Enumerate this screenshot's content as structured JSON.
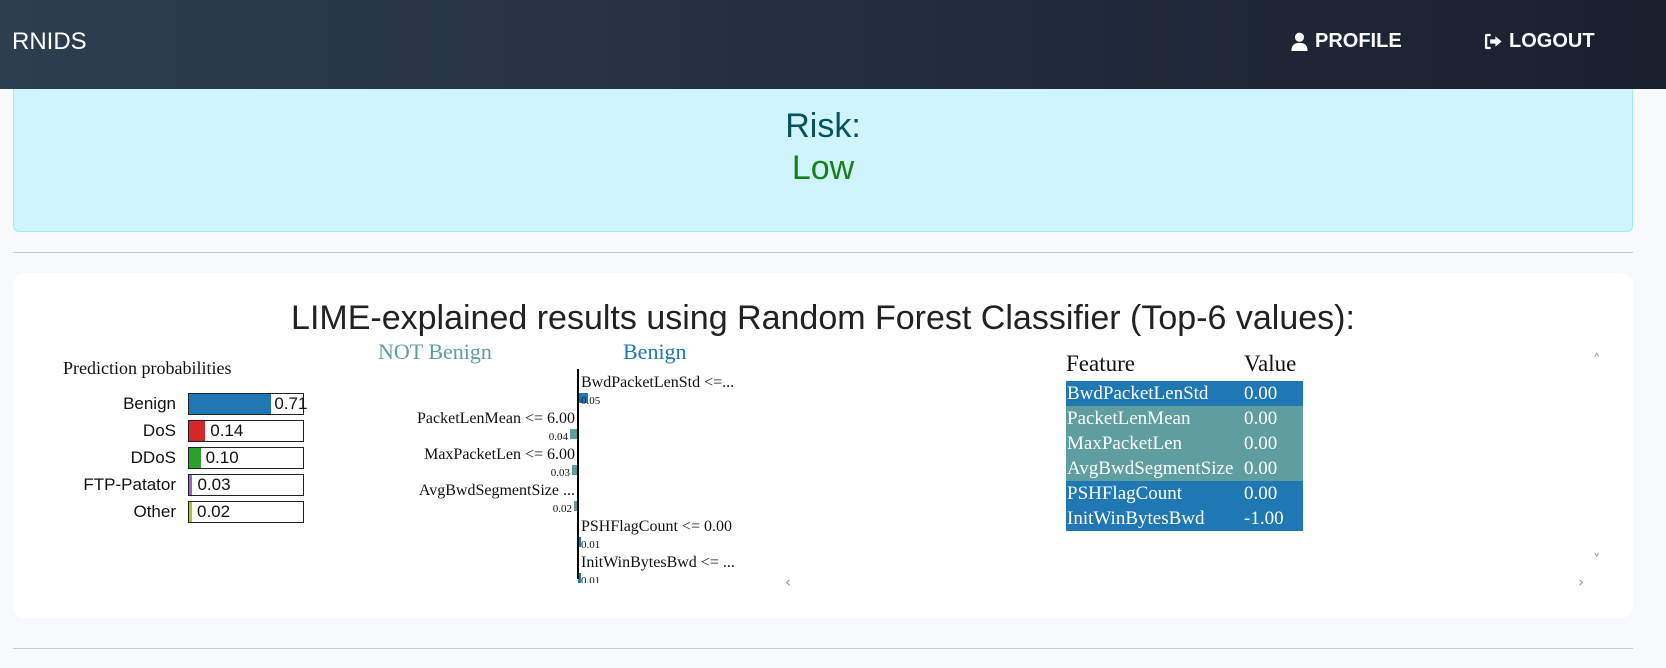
{
  "nav": {
    "brand": "RNIDS",
    "profile_label": "PROFILE",
    "logout_label": "LOGOUT"
  },
  "risk": {
    "label": "Risk:",
    "value": "Low",
    "value_color": "#198019"
  },
  "lime": {
    "title": "LIME-explained results using Random Forest Classifier (Top-6 values):",
    "prediction_title": "Prediction probabilities",
    "probabilities": [
      {
        "name": "Benign",
        "value": 0.71,
        "label": "0.71",
        "color": "#1f77b4"
      },
      {
        "name": "DoS",
        "value": 0.14,
        "label": "0.14",
        "color": "#d62728"
      },
      {
        "name": "DDoS",
        "value": 0.1,
        "label": "0.10",
        "color": "#2ca02c"
      },
      {
        "name": "FTP-Patator",
        "value": 0.03,
        "label": "0.03",
        "color": "#9467bd"
      },
      {
        "name": "Other",
        "value": 0.02,
        "label": "0.02",
        "color": "#bcbd22"
      }
    ],
    "explanation": {
      "neg_label": "NOT Benign",
      "pos_label": "Benign",
      "neg_color": "#5f9ea0",
      "pos_color": "#1f77b4",
      "features": [
        {
          "label": "BwdPacketLenStd <=...",
          "weight": 0.05,
          "weight_label": "0.05",
          "side": "pos"
        },
        {
          "label": "PacketLenMean <= 6.00",
          "weight": 0.04,
          "weight_label": "0.04",
          "side": "neg"
        },
        {
          "label": "MaxPacketLen <= 6.00",
          "weight": 0.03,
          "weight_label": "0.03",
          "side": "neg"
        },
        {
          "label": "AvgBwdSegmentSize ...",
          "weight": 0.02,
          "weight_label": "0.02",
          "side": "neg"
        },
        {
          "label": "PSHFlagCount <= 0.00",
          "weight": 0.01,
          "weight_label": "0.01",
          "side": "pos"
        },
        {
          "label": "InitWinBytesBwd <= ...",
          "weight": 0.01,
          "weight_label": "0.01",
          "side": "pos"
        }
      ]
    },
    "table": {
      "feature_header": "Feature",
      "value_header": "Value",
      "rows": [
        {
          "feature": "BwdPacketLenStd",
          "value": "0.00",
          "color": "#1f77b4"
        },
        {
          "feature": "PacketLenMean",
          "value": "0.00",
          "color": "#5f9ea0"
        },
        {
          "feature": "MaxPacketLen",
          "value": "0.00",
          "color": "#5f9ea0"
        },
        {
          "feature": "AvgBwdSegmentSize",
          "value": "0.00",
          "color": "#5f9ea0"
        },
        {
          "feature": "PSHFlagCount",
          "value": "0.00",
          "color": "#1f77b4"
        },
        {
          "feature": "InitWinBytesBwd",
          "value": "-1.00",
          "color": "#1f77b4"
        }
      ]
    },
    "scroll": {
      "up": "˄",
      "down": "˅",
      "left": "‹",
      "right": "›"
    }
  }
}
